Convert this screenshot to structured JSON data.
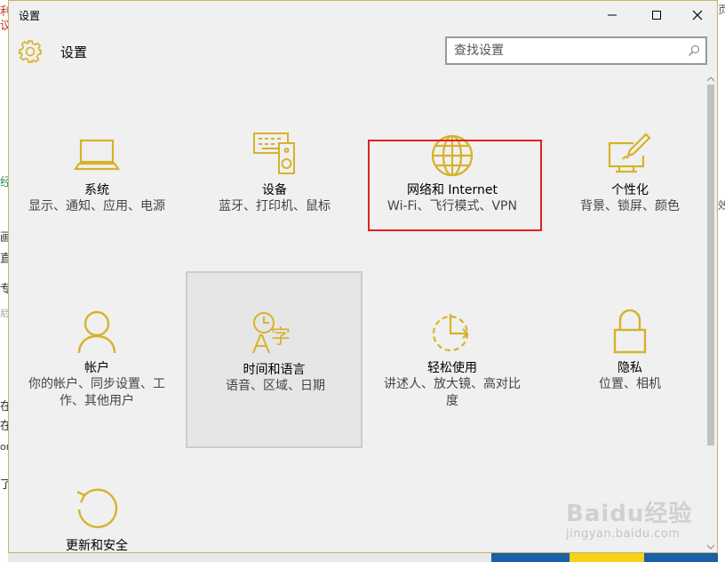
{
  "window": {
    "title": "设置",
    "minimize_label": "Minimize",
    "maximize_label": "Maximize",
    "close_label": "Close"
  },
  "header": {
    "title": "设置",
    "search_placeholder": "查找设置"
  },
  "accent_color": "#d6b22a",
  "highlight_color": "#e0201e",
  "categories": [
    {
      "icon": "laptop-icon",
      "name": "系统",
      "desc": "显示、通知、应用、电源"
    },
    {
      "icon": "devices-icon",
      "name": "设备",
      "desc": "蓝牙、打印机、鼠标"
    },
    {
      "icon": "globe-icon",
      "name": "网络和 Internet",
      "desc": "Wi-Fi、飞行模式、VPN"
    },
    {
      "icon": "personalization-icon",
      "name": "个性化",
      "desc": "背景、锁屏、颜色"
    },
    {
      "icon": "person-icon",
      "name": "帐户",
      "desc": "你的帐户、同步设置、工作、其他用户"
    },
    {
      "icon": "time-language-icon",
      "name": "时间和语言",
      "desc": "语音、区域、日期"
    },
    {
      "icon": "ease-of-access-icon",
      "name": "轻松使用",
      "desc": "讲述人、放大镜、高对比度"
    },
    {
      "icon": "lock-icon",
      "name": "隐私",
      "desc": "位置、相机"
    },
    {
      "icon": "update-icon",
      "name": "更新和安全",
      "desc": ""
    }
  ],
  "watermark": {
    "logo": "Baidu经验",
    "url": "jingyan.baidu.com"
  },
  "background": {
    "left_fragments": [
      "利",
      "议",
      "经",
      "画",
      "直",
      "专",
      "尼",
      "在",
      "在",
      "on",
      "了"
    ],
    "right_fragments": [
      "页",
      "效"
    ]
  }
}
